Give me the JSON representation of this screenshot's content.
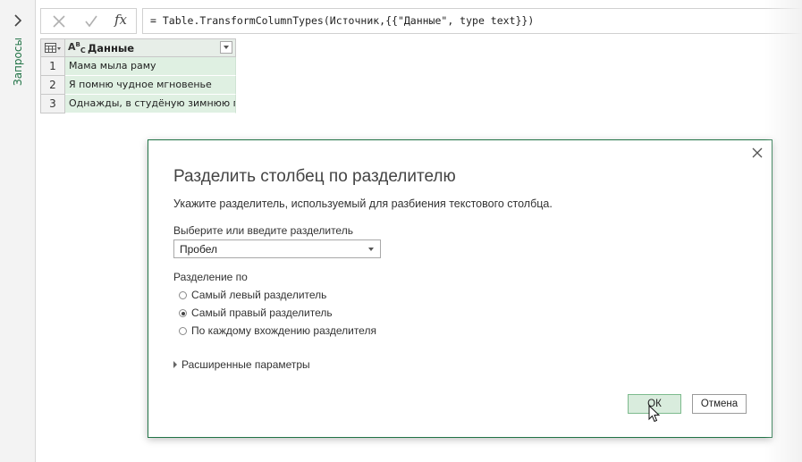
{
  "sidebar": {
    "label": "Запросы",
    "expand_icon": "chevron-right-icon"
  },
  "formula_bar": {
    "cancel_icon": "close-icon",
    "confirm_icon": "check-icon",
    "fx_label": "fx",
    "formula": "= Table.TransformColumnTypes(Источник,{{\"Данные\", type text}})"
  },
  "grid": {
    "column": {
      "type_icon": "text-type-icon",
      "type_label": "ABC",
      "name": "Данные"
    },
    "rows": [
      {
        "num": "1",
        "value": "Мама мыла раму"
      },
      {
        "num": "2",
        "value": "Я помню чудное мгновенье"
      },
      {
        "num": "3",
        "value": "Однажды, в студёную зимнюю по..."
      }
    ]
  },
  "dialog": {
    "title": "Разделить столбец по разделителю",
    "description": "Укажите разделитель, используемый для разбиения текстового столбца.",
    "delimiter_label": "Выберите или введите разделитель",
    "delimiter_value": "Пробел",
    "split_label": "Разделение по",
    "options": [
      {
        "label": "Самый левый разделитель",
        "checked": false
      },
      {
        "label": "Самый правый разделитель",
        "checked": true
      },
      {
        "label": "По каждому вхождению разделителя",
        "checked": false
      }
    ],
    "advanced_label": "Расширенные параметры",
    "ok_label": "ОК",
    "cancel_label": "Отмена"
  },
  "colors": {
    "accent": "#217346",
    "selection": "#dff0e2"
  }
}
